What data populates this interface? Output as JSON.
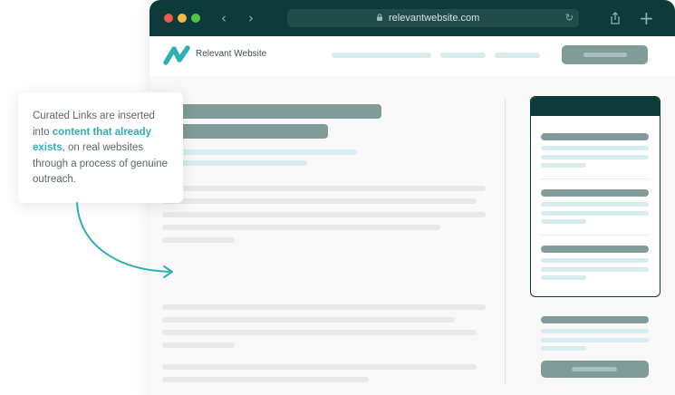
{
  "browser": {
    "url": "relevantwebsite.com",
    "controls": {
      "back_glyph": "‹",
      "forward_glyph": "›",
      "reload_glyph": "↻",
      "new_tab_glyph": "+"
    },
    "traffic_lights": [
      "#ee5a52",
      "#f4b942",
      "#53c249"
    ],
    "icons": [
      "lock-icon",
      "share-icon",
      "reload-icon",
      "plus-icon"
    ]
  },
  "site": {
    "name": "Relevant Website",
    "logo_icon": "relevant-website-logo-icon",
    "accent": "#2eb0b3",
    "dark": "#0d3b39"
  },
  "callout": {
    "text_before": "Curated Links are inserted into ",
    "highlight": "content that already exists",
    "text_after": ", on real websites through a process of genuine outreach."
  }
}
